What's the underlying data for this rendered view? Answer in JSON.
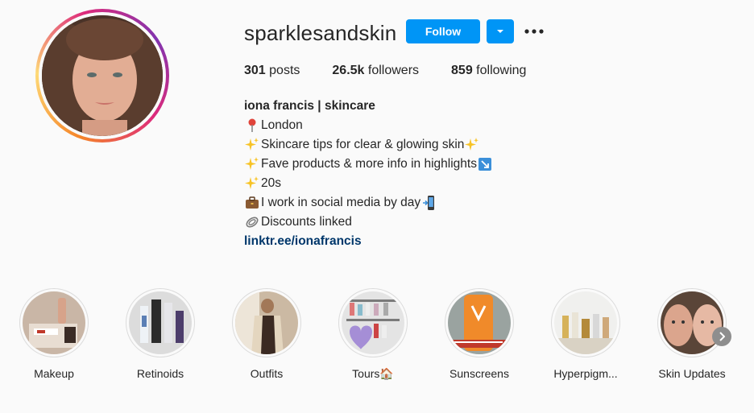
{
  "profile": {
    "username": "sparklesandskin",
    "follow_label": "Follow",
    "stats": {
      "posts_count": "301",
      "posts_label": " posts",
      "followers_count": "26.5k",
      "followers_label": " followers",
      "following_count": "859",
      "following_label": " following"
    },
    "bio": {
      "name": "iona francis | skincare",
      "lines": [
        {
          "icon": "pin-icon",
          "text": "London"
        },
        {
          "icon": "sparkles-icon",
          "text": "Skincare tips for clear & glowing skin",
          "trail_icon": "sparkles-icon"
        },
        {
          "icon": "sparkles-icon",
          "text": "Fave products & more info in highlights ",
          "trail_icon": "arrow-down-right-icon"
        },
        {
          "icon": "sparkles-icon",
          "text": "20s"
        },
        {
          "icon": "briefcase-icon",
          "text": "I work in social media by day ",
          "trail_icon": "phone-icon"
        },
        {
          "icon": "paperclip-icon",
          "text": "Discounts linked"
        }
      ],
      "link": "linktr.ee/ionafrancis"
    }
  },
  "highlights": [
    {
      "label": "Makeup"
    },
    {
      "label": "Retinoids"
    },
    {
      "label": "Outfits"
    },
    {
      "label": "Tours🏠"
    },
    {
      "label": "Sunscreens"
    },
    {
      "label": "Hyperpigm..."
    },
    {
      "label": "Skin Updates"
    }
  ],
  "colors": {
    "accent": "#0095f6",
    "link": "#00376b",
    "text": "#262626",
    "background": "#fafafa"
  }
}
